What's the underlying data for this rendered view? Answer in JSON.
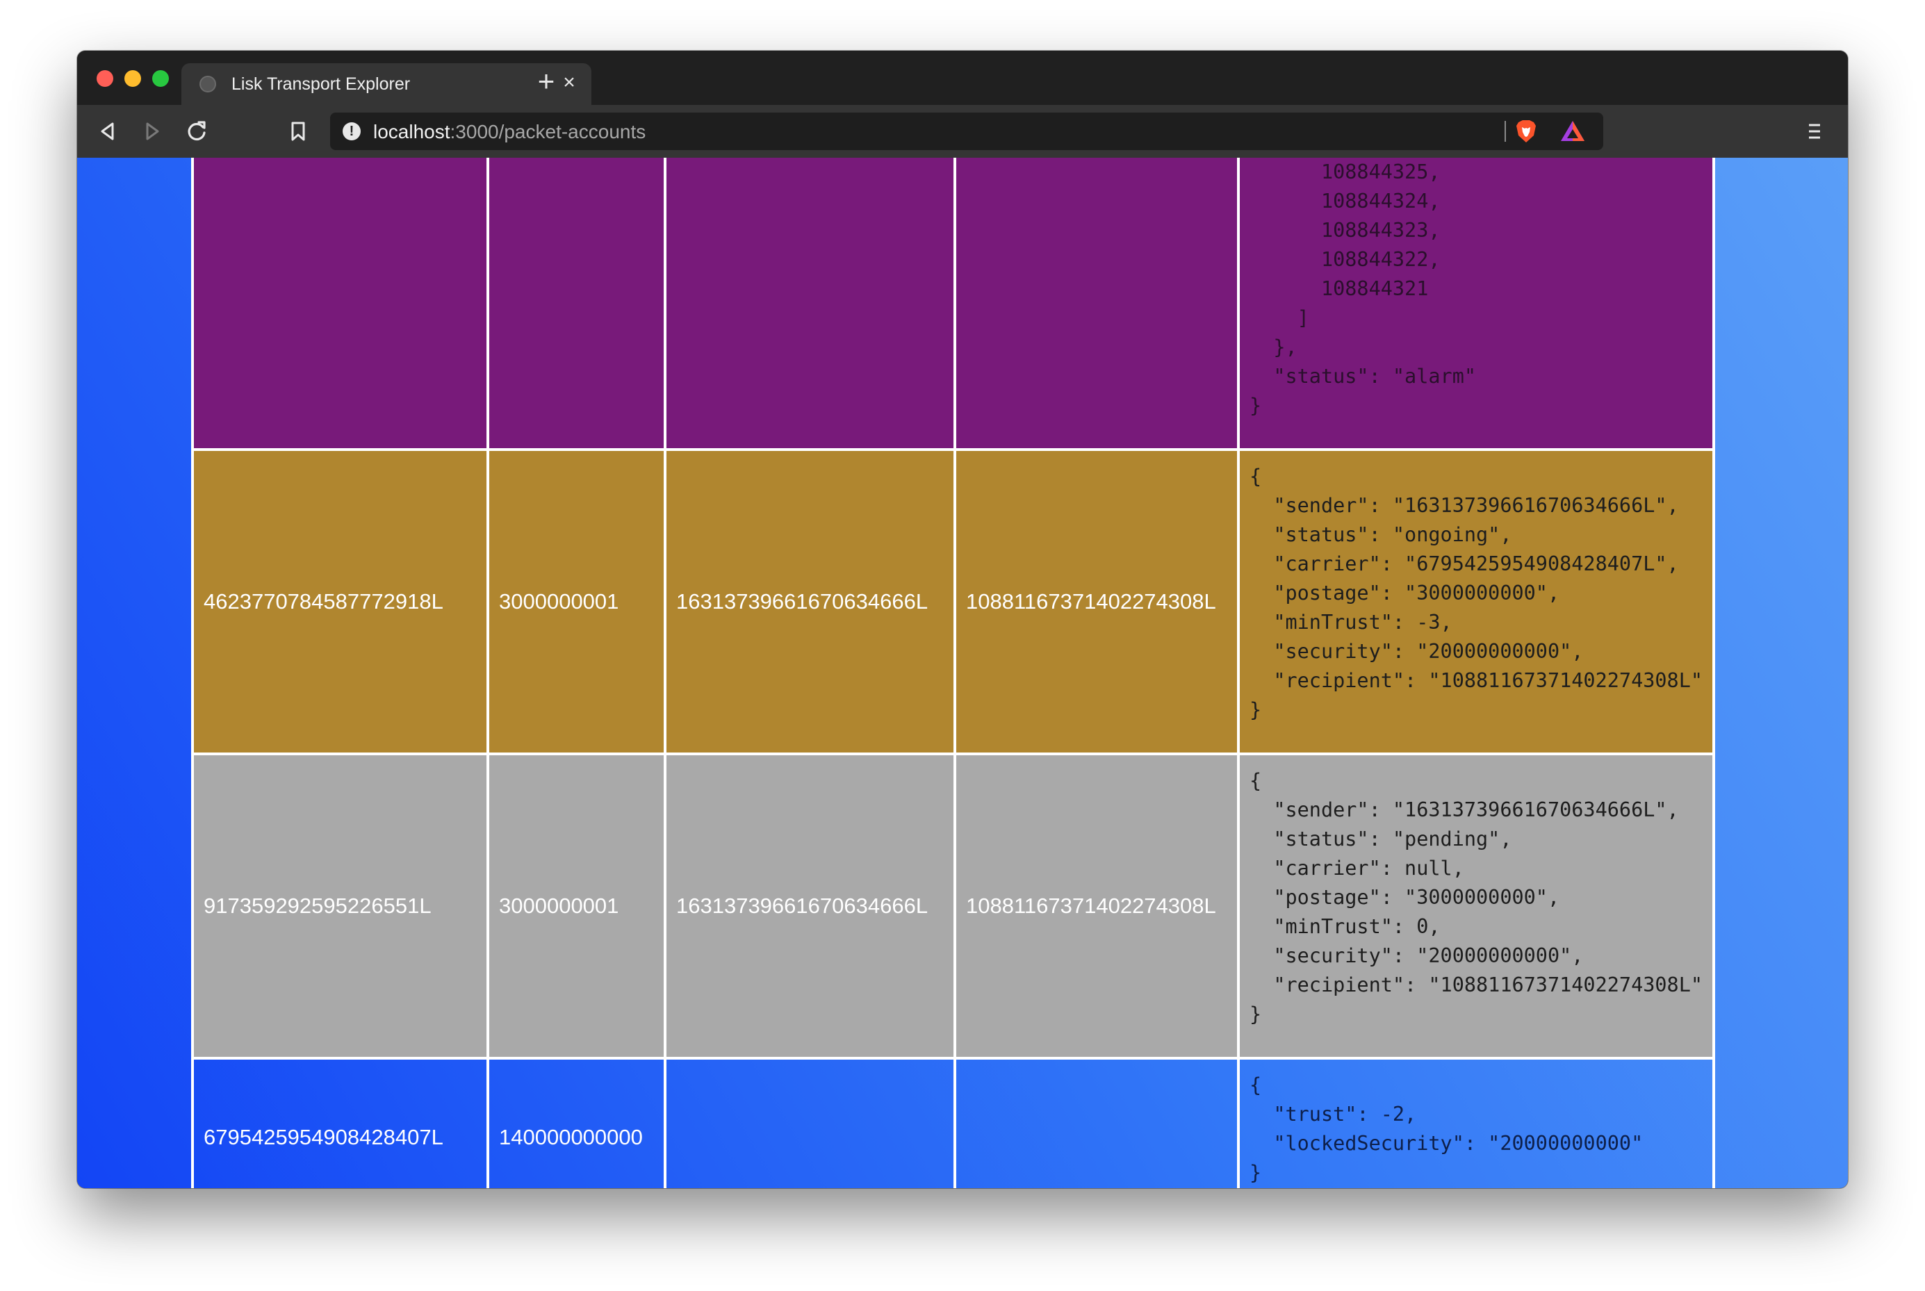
{
  "browser": {
    "tab_title": "Lisk Transport Explorer",
    "tab_close": "×",
    "new_tab": "+",
    "url_host": "localhost",
    "url_path": ":3000/packet-accounts",
    "info_icon": "!"
  },
  "icons": {
    "back": "back-arrow-icon",
    "forward": "forward-arrow-icon",
    "reload": "reload-icon",
    "bookmark": "bookmark-icon",
    "site_info": "info-icon",
    "brave_shields": "brave-lion-icon",
    "brave_rewards": "brave-rewards-triangle-icon",
    "menu": "hamburger-menu-icon"
  },
  "colors": {
    "row_purple": "#781a7a",
    "row_gold": "#b0862f",
    "row_gray": "#a9a9a9",
    "background_gradient_start": "#1345f5",
    "background_gradient_end": "#5a9ef8"
  },
  "table": {
    "rows": [
      {
        "style": "purple",
        "address": "",
        "balance": "",
        "sender": "",
        "recipient": "",
        "asset": "      108844325,\n      108844324,\n      108844323,\n      108844322,\n      108844321\n    ]\n  },\n  \"status\": \"alarm\"\n}"
      },
      {
        "style": "gold",
        "address": "4623770784587772918L",
        "balance": "3000000001",
        "sender": "16313739661670634666L",
        "recipient": "10881167371402274308L",
        "asset": "{\n  \"sender\": \"16313739661670634666L\",\n  \"status\": \"ongoing\",\n  \"carrier\": \"6795425954908428407L\",\n  \"postage\": \"3000000000\",\n  \"minTrust\": -3,\n  \"security\": \"20000000000\",\n  \"recipient\": \"10881167371402274308L\"\n}"
      },
      {
        "style": "gray",
        "address": "917359292595226551L",
        "balance": "3000000001",
        "sender": "16313739661670634666L",
        "recipient": "10881167371402274308L",
        "asset": "{\n  \"sender\": \"16313739661670634666L\",\n  \"status\": \"pending\",\n  \"carrier\": null,\n  \"postage\": \"3000000000\",\n  \"minTrust\": 0,\n  \"security\": \"20000000000\",\n  \"recipient\": \"10881167371402274308L\"\n}"
      },
      {
        "style": "blue",
        "address": "6795425954908428407L",
        "balance": "140000000000",
        "sender": "",
        "recipient": "",
        "asset": "{\n  \"trust\": -2,\n  \"lockedSecurity\": \"20000000000\"\n}"
      }
    ]
  }
}
